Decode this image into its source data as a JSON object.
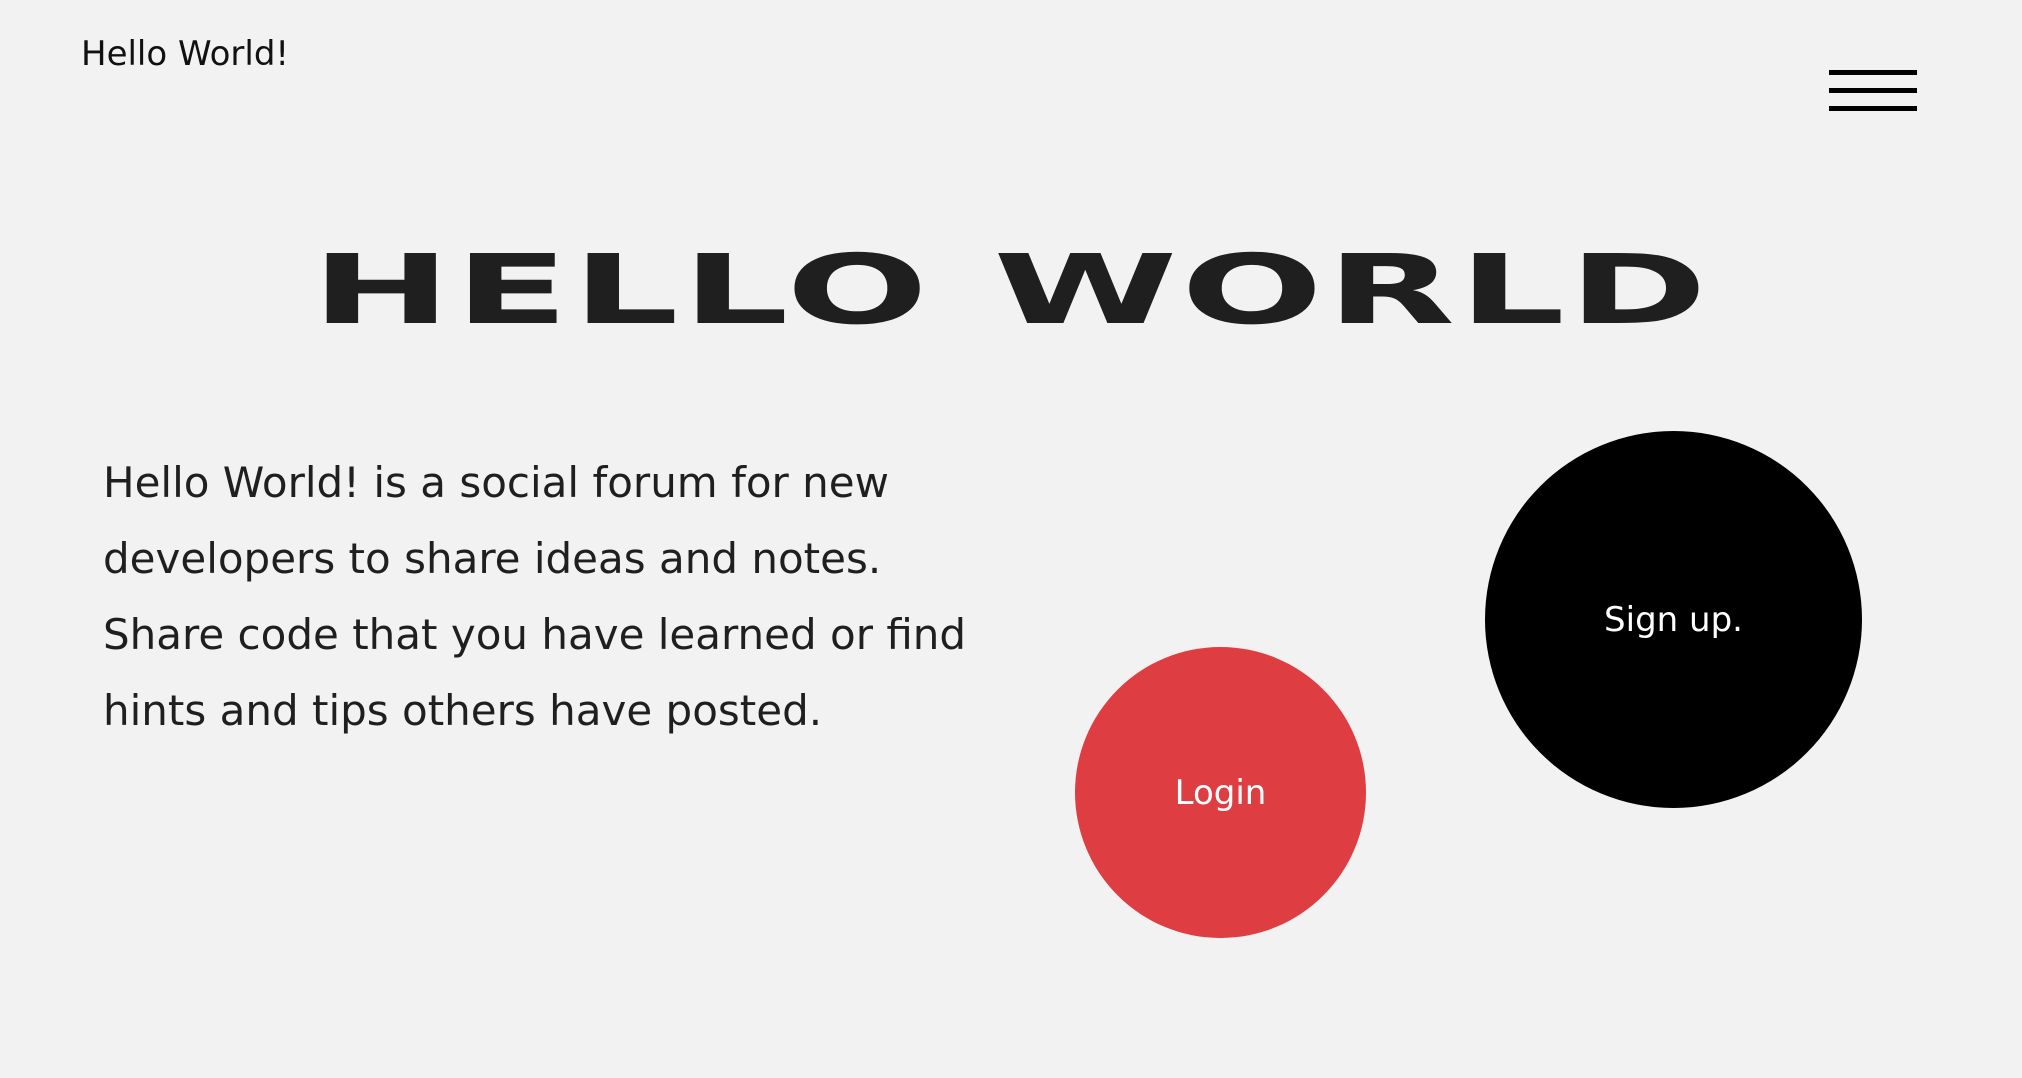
{
  "header": {
    "brand": "Hello World!",
    "menu_icon": "hamburger-menu-icon"
  },
  "hero": {
    "title": "HELLO WORLD",
    "description": "Hello World! is a social forum for new developers to share ideas and notes. Share code that you have learned or find hints and tips others have posted."
  },
  "actions": {
    "signup_label": "Sign up.",
    "login_label": "Login"
  },
  "colors": {
    "background": "#f2f2f2",
    "text": "#1f1f1f",
    "signup_bg": "#000000",
    "login_bg": "#de3e41",
    "button_text": "#ffffff"
  }
}
